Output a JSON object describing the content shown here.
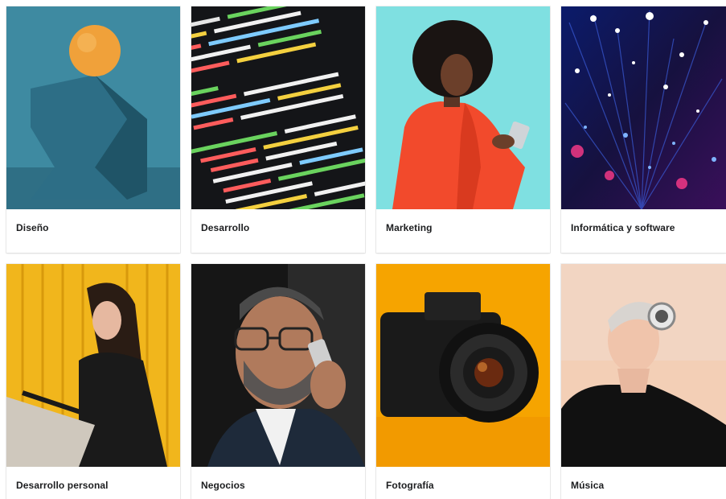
{
  "categories": [
    {
      "label": "Diseño",
      "image": "geometric-sphere-sculpture",
      "bg": "#3b8aa0"
    },
    {
      "label": "Desarrollo",
      "image": "code-editor-screen",
      "bg": "#121418"
    },
    {
      "label": "Marketing",
      "image": "woman-red-jacket-phone",
      "bg": "#7fdfe0"
    },
    {
      "label": "Informática y software",
      "image": "fiber-optic-lights",
      "bg": "#0d1a5c"
    },
    {
      "label": "Desarrollo personal",
      "image": "woman-writing-yellow-wall",
      "bg": "#f1b61c"
    },
    {
      "label": "Negocios",
      "image": "man-phone-call",
      "bg": "#1a1a1a"
    },
    {
      "label": "Fotografía",
      "image": "camera-on-orange",
      "bg": "#f5a300"
    },
    {
      "label": "Música",
      "image": "woman-headphones",
      "bg": "#f2d7c4"
    }
  ]
}
